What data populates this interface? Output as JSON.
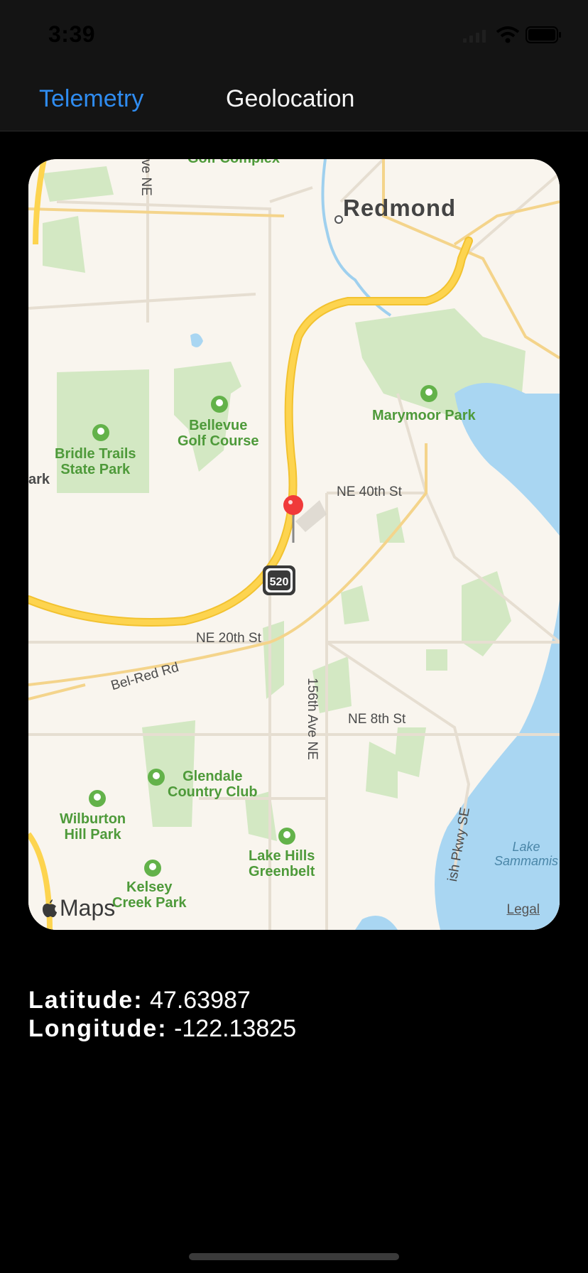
{
  "status_bar": {
    "time": "3:39"
  },
  "nav": {
    "back_label": "Telemetry",
    "title": "Geolocation"
  },
  "map": {
    "city": "Redmond",
    "labels": {
      "ne_40th": "NE 40th St",
      "ne_20th": "NE 20th St",
      "ne_8th": "NE 8th St",
      "bel_red": "Bel-Red Rd",
      "ave_156th": "156th Ave NE",
      "ve_ne": "ve NE",
      "pkwy": "ish Pkwy SE",
      "golf_top": "Golf Complex",
      "ark": "ark"
    },
    "parks": {
      "bellevue_golf": "Bellevue\nGolf Course",
      "bridle": "Bridle Trails\nState Park",
      "marymoor": "Marymoor Park",
      "glendale": "Glendale\nCountry Club",
      "wilburton": "Wilburton\nHill Park",
      "lake_hills": "Lake Hills\nGreenbelt",
      "kelsey": "Kelsey\nCreek Park"
    },
    "lake": "Lake\nSammamis",
    "highway_shield": "520",
    "logo": "Maps",
    "legal": "Legal"
  },
  "coordinates": {
    "latitude_label": "Latitude:",
    "latitude_value": "47.63987",
    "longitude_label": "Longitude:",
    "longitude_value": "-122.13825"
  },
  "colors": {
    "accent": "#2f8cf0",
    "nav_background": "#141414",
    "page_background": "#000000",
    "highway": "#fdd44f",
    "park": "#cfe6bf",
    "water": "#a7d6f3",
    "pin": "#f03a3a"
  }
}
